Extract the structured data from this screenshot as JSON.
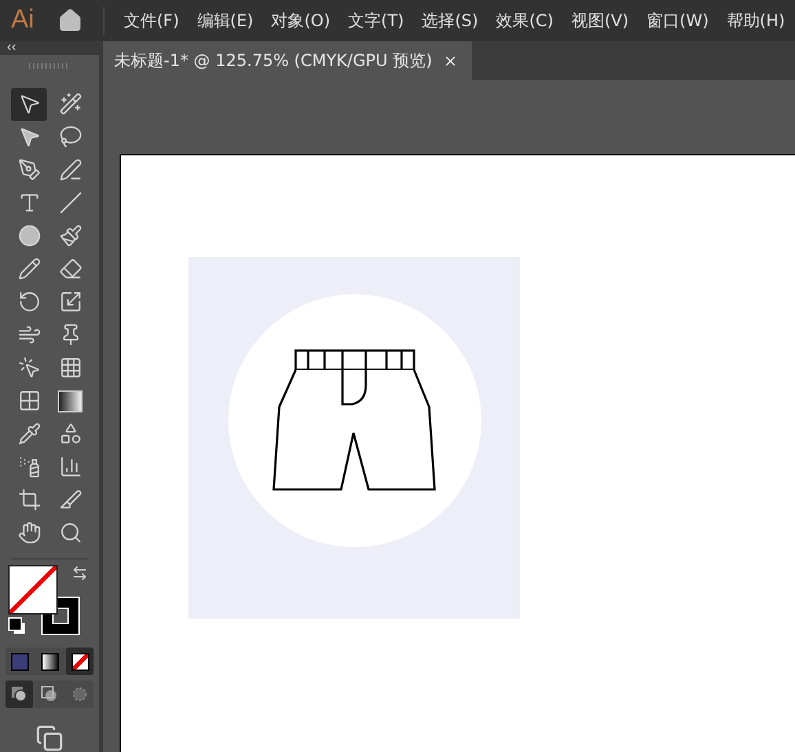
{
  "app": {
    "logo": "Ai"
  },
  "menu": [
    {
      "label": "文件(F)"
    },
    {
      "label": "编辑(E)"
    },
    {
      "label": "对象(O)"
    },
    {
      "label": "文字(T)"
    },
    {
      "label": "选择(S)"
    },
    {
      "label": "效果(C)"
    },
    {
      "label": "视图(V)"
    },
    {
      "label": "窗口(W)"
    },
    {
      "label": "帮助(H)"
    }
  ],
  "panel": {
    "collapse": "‹‹"
  },
  "document_tab": {
    "title": "未标题-1* @ 125.75% (CMYK/GPU 预览)",
    "selected": true
  },
  "tools": [
    {
      "kind": "selection",
      "selected": true
    },
    {
      "kind": "magic-wand",
      "selected": false
    },
    {
      "kind": "direct-selection",
      "selected": false
    },
    {
      "kind": "lasso",
      "selected": false
    },
    {
      "kind": "pen",
      "selected": false
    },
    {
      "kind": "curvature",
      "selected": false
    },
    {
      "kind": "type",
      "selected": false
    },
    {
      "kind": "line",
      "selected": false
    },
    {
      "kind": "ellipse",
      "selected": false
    },
    {
      "kind": "brush",
      "selected": false
    },
    {
      "kind": "pencil",
      "selected": false
    },
    {
      "kind": "eraser",
      "selected": false
    },
    {
      "kind": "rotate",
      "selected": false
    },
    {
      "kind": "scale",
      "selected": false
    },
    {
      "kind": "warp",
      "selected": false
    },
    {
      "kind": "pin",
      "selected": false
    },
    {
      "kind": "shape-builder",
      "selected": false
    },
    {
      "kind": "perspective",
      "selected": false
    },
    {
      "kind": "mesh",
      "selected": false
    },
    {
      "kind": "gradient",
      "selected": false
    },
    {
      "kind": "eyedropper",
      "selected": false
    },
    {
      "kind": "blend",
      "selected": false
    },
    {
      "kind": "spray",
      "selected": false
    },
    {
      "kind": "graph",
      "selected": false
    },
    {
      "kind": "artboard",
      "selected": false
    },
    {
      "kind": "slice",
      "selected": false
    },
    {
      "kind": "hand",
      "selected": false
    },
    {
      "kind": "zoom",
      "selected": false
    }
  ],
  "color_modes": [
    {
      "kind": "color",
      "selected": false
    },
    {
      "kind": "gradient",
      "selected": false
    },
    {
      "kind": "none",
      "selected": true
    }
  ],
  "draw_modes": [
    {
      "kind": "normal",
      "selected": true
    },
    {
      "kind": "behind",
      "selected": false
    },
    {
      "kind": "inside",
      "selected": false
    }
  ]
}
